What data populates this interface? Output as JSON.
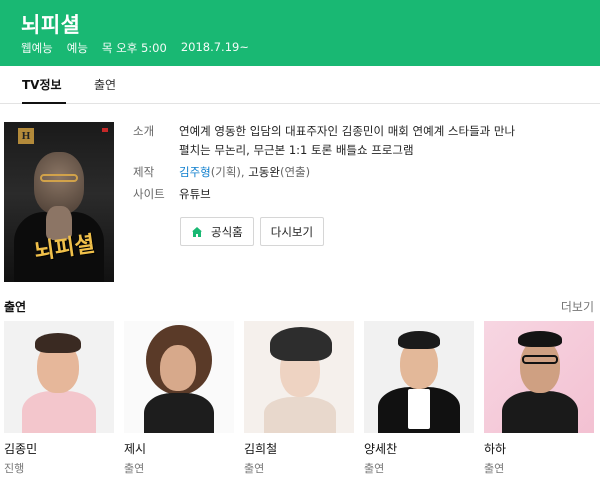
{
  "header": {
    "title": "뇌피셜",
    "meta": [
      "웹예능",
      "예능",
      "목 오후 5:00",
      "2018.7.19~"
    ]
  },
  "tabs": [
    {
      "label": "TV정보",
      "active": true
    },
    {
      "label": "출연",
      "active": false
    }
  ],
  "poster": {
    "logo_letter": "H",
    "title_text": "뇌피셜"
  },
  "info": {
    "intro_label": "소개",
    "intro_text_1": "연예계 영동한 입담의 대표주자인 김종민이 매회 연예계 스타들과 만나",
    "intro_text_2": "펼치는 무논리, 무근본 1:1 토론 배틀쇼 프로그램",
    "production_label": "제작",
    "producer_1": "김주형",
    "producer_1_role": "(기획), ",
    "producer_2": "고동완",
    "producer_2_role": "(연출)",
    "site_label": "사이트",
    "site_link": "유튜브"
  },
  "buttons": {
    "official": "공식홈",
    "replay": "다시보기"
  },
  "cast_section": {
    "title": "출연",
    "more": "더보기"
  },
  "cast": [
    {
      "name": "김종민",
      "role": "진행"
    },
    {
      "name": "제시",
      "role": "출연"
    },
    {
      "name": "김희철",
      "role": "출연"
    },
    {
      "name": "양세찬",
      "role": "출연"
    },
    {
      "name": "하하",
      "role": "출연"
    }
  ],
  "colors": {
    "brand": "#19b873",
    "link": "#0f7fce"
  }
}
